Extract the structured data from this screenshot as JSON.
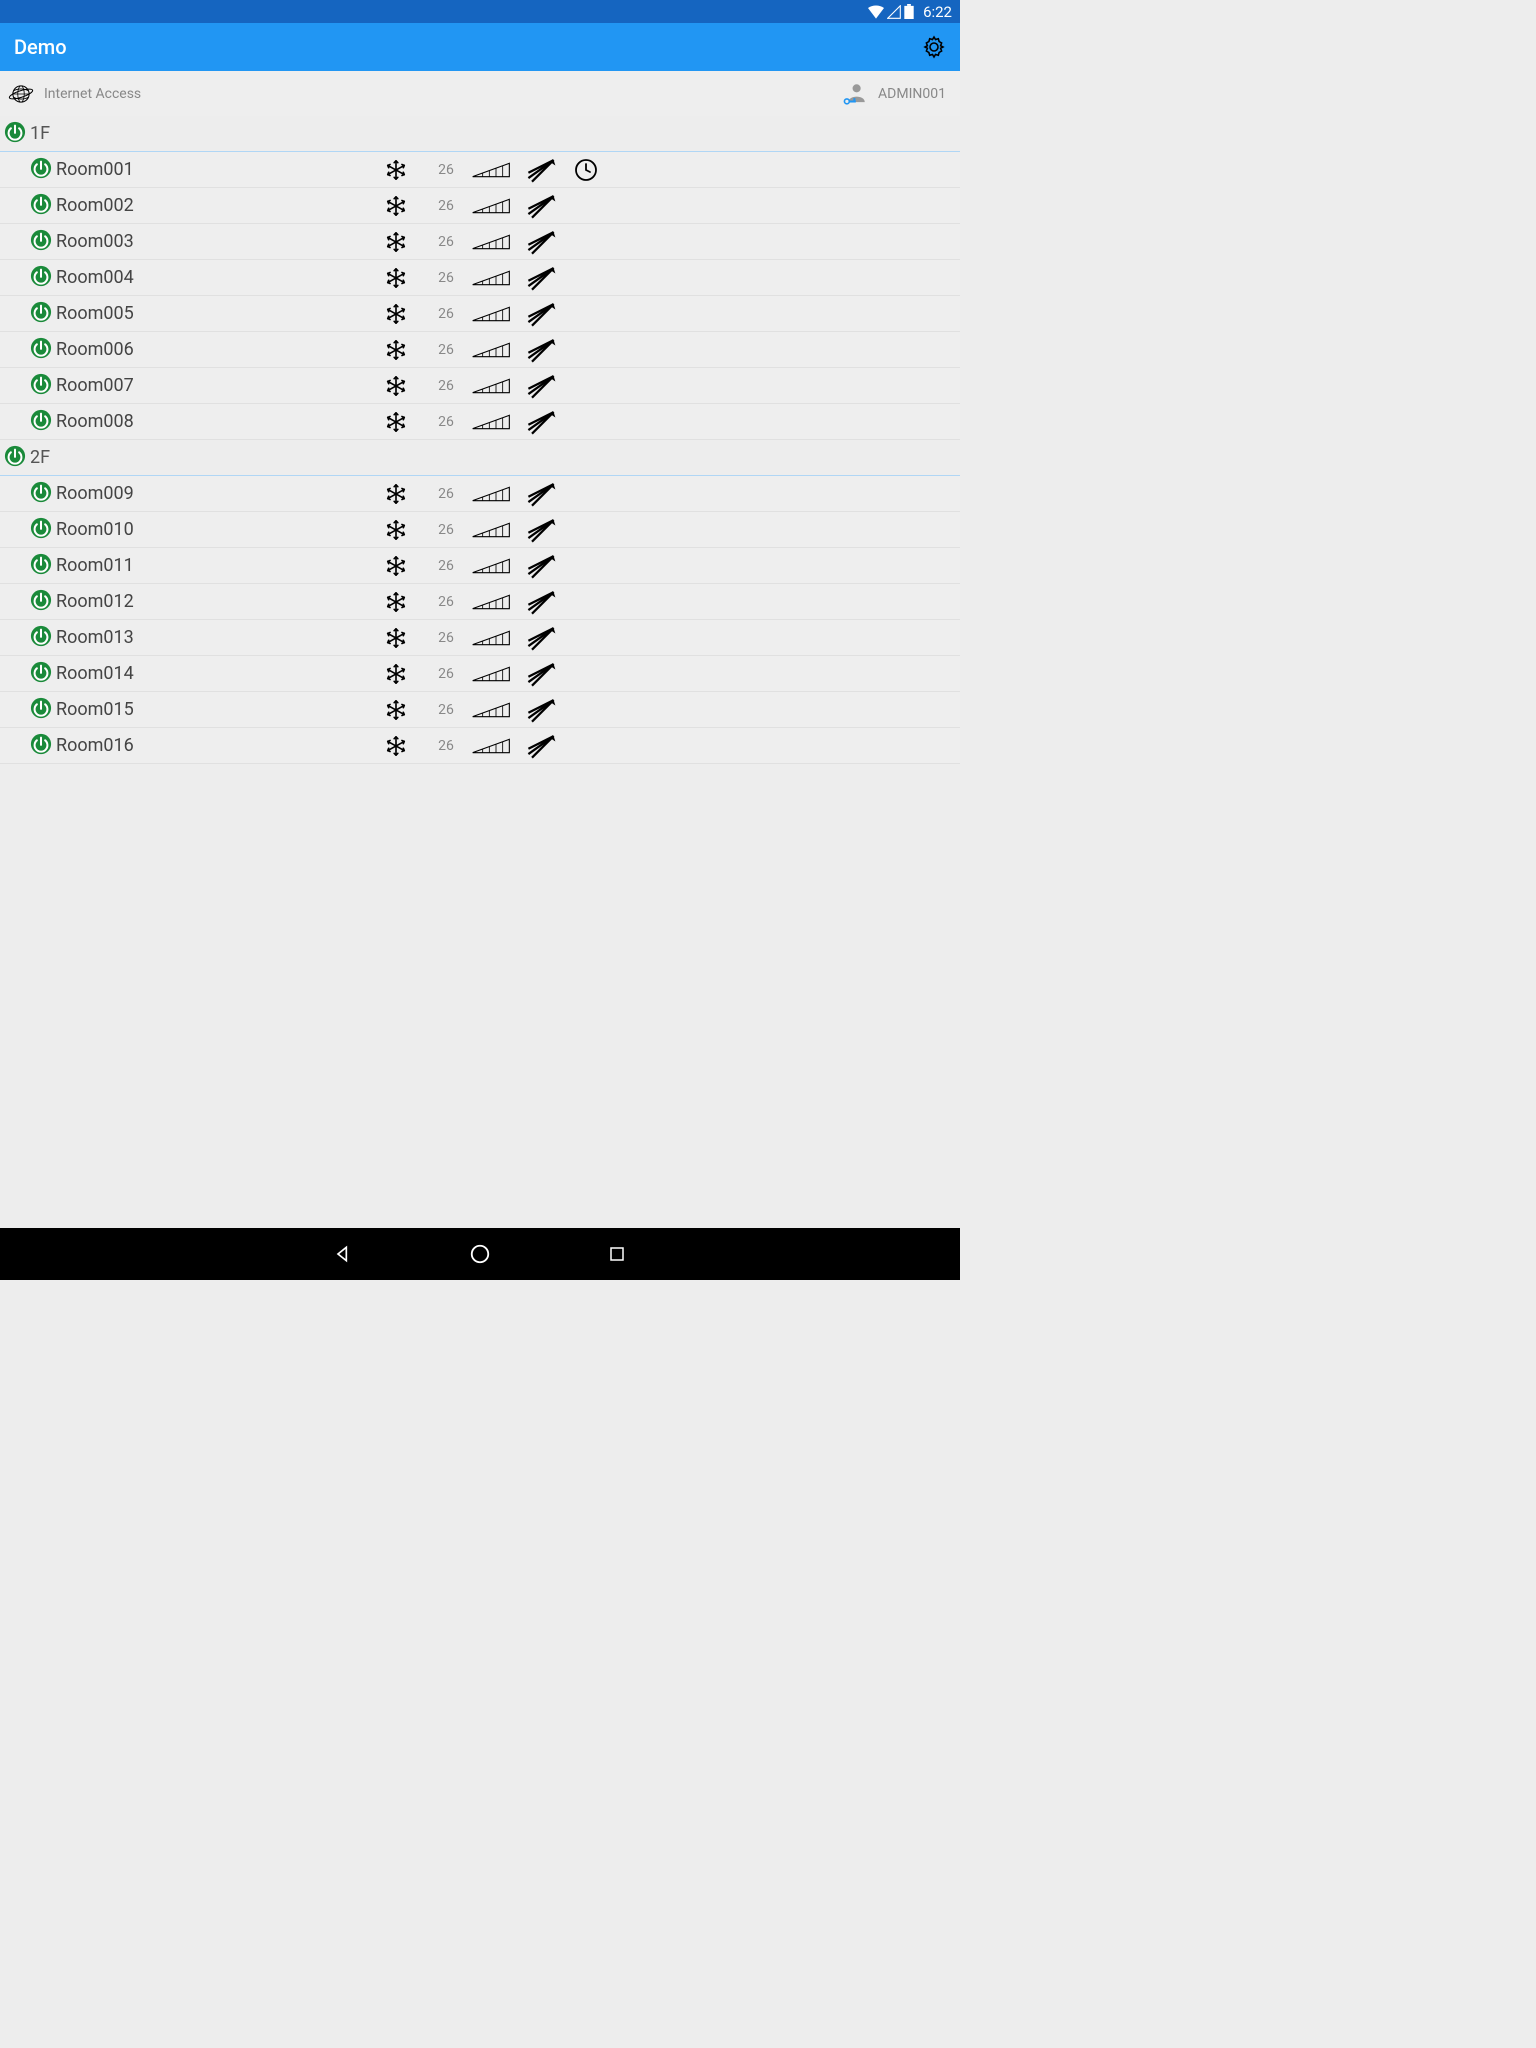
{
  "status": {
    "time": "6:22"
  },
  "header": {
    "title": "Demo"
  },
  "info": {
    "access_text": "Internet Access",
    "user": "ADMIN001"
  },
  "groups": [
    {
      "name": "1F",
      "rooms": [
        {
          "name": "Room001",
          "temp": "26",
          "has_timer": true
        },
        {
          "name": "Room002",
          "temp": "26",
          "has_timer": false
        },
        {
          "name": "Room003",
          "temp": "26",
          "has_timer": false
        },
        {
          "name": "Room004",
          "temp": "26",
          "has_timer": false
        },
        {
          "name": "Room005",
          "temp": "26",
          "has_timer": false
        },
        {
          "name": "Room006",
          "temp": "26",
          "has_timer": false
        },
        {
          "name": "Room007",
          "temp": "26",
          "has_timer": false
        },
        {
          "name": "Room008",
          "temp": "26",
          "has_timer": false
        }
      ]
    },
    {
      "name": "2F",
      "rooms": [
        {
          "name": "Room009",
          "temp": "26",
          "has_timer": false
        },
        {
          "name": "Room010",
          "temp": "26",
          "has_timer": false
        },
        {
          "name": "Room011",
          "temp": "26",
          "has_timer": false
        },
        {
          "name": "Room012",
          "temp": "26",
          "has_timer": false
        },
        {
          "name": "Room013",
          "temp": "26",
          "has_timer": false
        },
        {
          "name": "Room014",
          "temp": "26",
          "has_timer": false
        },
        {
          "name": "Room015",
          "temp": "26",
          "has_timer": false
        },
        {
          "name": "Room016",
          "temp": "26",
          "has_timer": false
        }
      ]
    }
  ]
}
